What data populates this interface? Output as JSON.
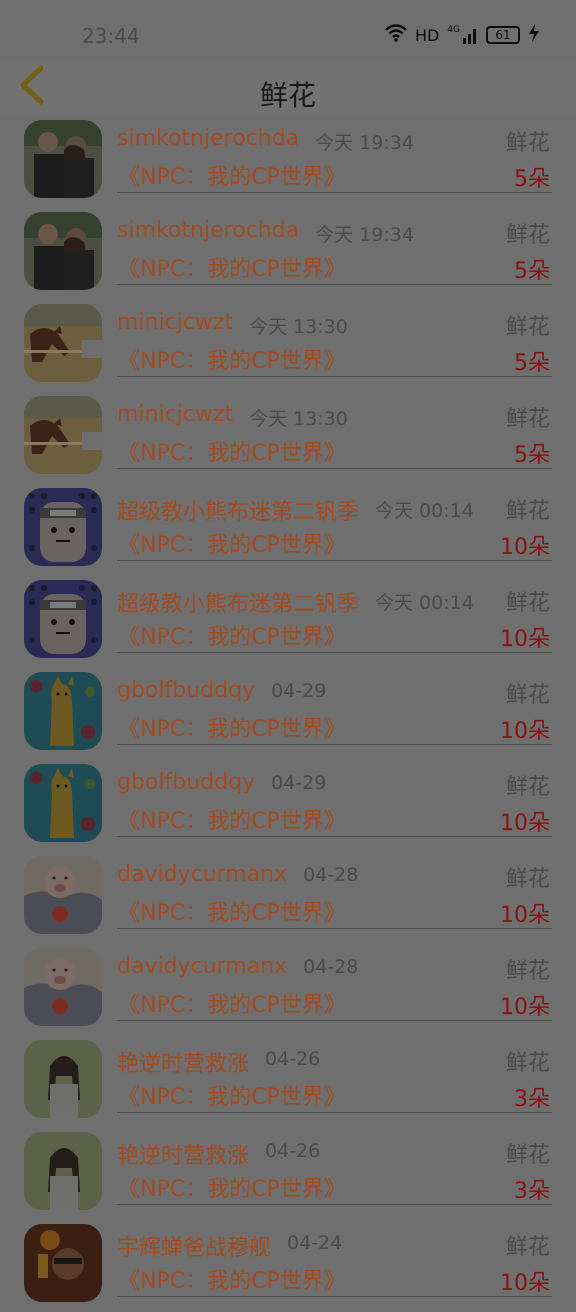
{
  "status_bar": {
    "time": "23:44",
    "network": "HD",
    "signal": "4G",
    "battery": "61"
  },
  "header": {
    "title": "鲜花"
  },
  "items": [
    {
      "username": "simkotnjerochda",
      "time": "今天 19:34",
      "type": "鲜花",
      "book": "《NPC：我的CP世界》",
      "count": "5朵",
      "avatar_icon": "couple-photo-avatar"
    },
    {
      "username": "simkotnjerochda",
      "time": "今天 19:34",
      "type": "鲜花",
      "book": "《NPC：我的CP世界》",
      "count": "5朵",
      "avatar_icon": "couple-photo-avatar"
    },
    {
      "username": "minicjcwzt",
      "time": "今天 13:30",
      "type": "鲜花",
      "book": "《NPC：我的CP世界》",
      "count": "5朵",
      "avatar_icon": "horse-avatar"
    },
    {
      "username": "minicjcwzt",
      "time": "今天 13:30",
      "type": "鲜花",
      "book": "《NPC：我的CP世界》",
      "count": "5朵",
      "avatar_icon": "horse-avatar"
    },
    {
      "username": "超级教小熊布迷第二钒季",
      "time": "今天 00:14",
      "type": "鲜花",
      "book": "《NPC：我的CP世界》",
      "count": "10朵",
      "avatar_icon": "cartoon-face-avatar"
    },
    {
      "username": "超级教小熊布迷第二钒季",
      "time": "今天 00:14",
      "type": "鲜花",
      "book": "《NPC：我的CP世界》",
      "count": "10朵",
      "avatar_icon": "cartoon-face-avatar"
    },
    {
      "username": "gbolfbuddqy",
      "time": "04-29",
      "type": "鲜花",
      "book": "《NPC：我的CP世界》",
      "count": "10朵",
      "avatar_icon": "cat-painting-avatar"
    },
    {
      "username": "gbolfbuddqy",
      "time": "04-29",
      "type": "鲜花",
      "book": "《NPC：我的CP世界》",
      "count": "10朵",
      "avatar_icon": "cat-painting-avatar"
    },
    {
      "username": "davidycurmanx",
      "time": "04-28",
      "type": "鲜花",
      "book": "《NPC：我的CP世界》",
      "count": "10朵",
      "avatar_icon": "pig-illustration-avatar"
    },
    {
      "username": "davidycurmanx",
      "time": "04-28",
      "type": "鲜花",
      "book": "《NPC：我的CP世界》",
      "count": "10朵",
      "avatar_icon": "pig-illustration-avatar"
    },
    {
      "username": "艳逆时营救涨",
      "time": "04-26",
      "type": "鲜花",
      "book": "《NPC：我的CP世界》",
      "count": "3朵",
      "avatar_icon": "girl-portrait-avatar"
    },
    {
      "username": "艳逆时营救涨",
      "time": "04-26",
      "type": "鲜花",
      "book": "《NPC：我的CP世界》",
      "count": "3朵",
      "avatar_icon": "girl-portrait-avatar"
    },
    {
      "username": "宇辉蝉爸战穆舰",
      "time": "04-24",
      "type": "鲜花",
      "book": "《NPC：我的CP世界》",
      "count": "10朵",
      "avatar_icon": "man-portrait-avatar"
    }
  ]
}
